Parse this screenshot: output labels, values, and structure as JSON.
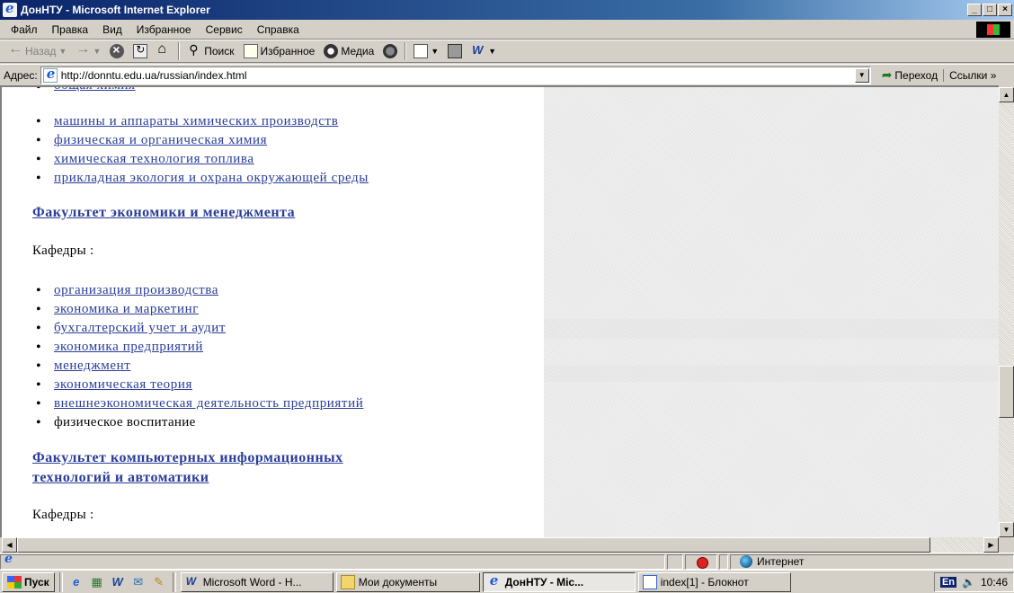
{
  "window": {
    "title": "ДонНТУ - Microsoft Internet Explorer"
  },
  "menu": [
    "Файл",
    "Правка",
    "Вид",
    "Избранное",
    "Сервис",
    "Справка"
  ],
  "toolbar": {
    "back": "Назад",
    "search": "Поиск",
    "favorites": "Избранное",
    "media": "Медиа"
  },
  "address": {
    "label": "Адрес:",
    "url": "http://donntu.edu.ua/russian/index.html",
    "go": "Переход",
    "links": "Ссылки"
  },
  "content": {
    "top_partial": "общая химия",
    "list1": [
      "машины и аппараты химических производств",
      "физическая и органическая химия",
      "химическая технология топлива",
      "прикладная экология и охрана окружающей среды"
    ],
    "faculty1": "Факультет экономики и менеджмента",
    "kafedry": "Кафедры :",
    "list2": [
      "организация производства",
      "экономика и маркетинг",
      "бухгалтерский учет и аудит",
      "экономика предприятий",
      "менеджмент",
      "экономическая теория",
      "внешнеэкономическая деятельность предприятий"
    ],
    "list2_plain": "физическое воспитание",
    "faculty2_line1": "Факультет компьютерных информационных",
    "faculty2_line2": "технологий и автоматики",
    "kafedry2": "Кафедры :"
  },
  "status": {
    "zone": "Интернет"
  },
  "taskbar": {
    "start": "Пуск",
    "tasks": [
      "Microsoft Word - Н...",
      "Мои документы",
      "ДонНТУ - Mic...",
      "index[1] - Блокнот"
    ],
    "lang": "En",
    "clock": "10:46"
  }
}
